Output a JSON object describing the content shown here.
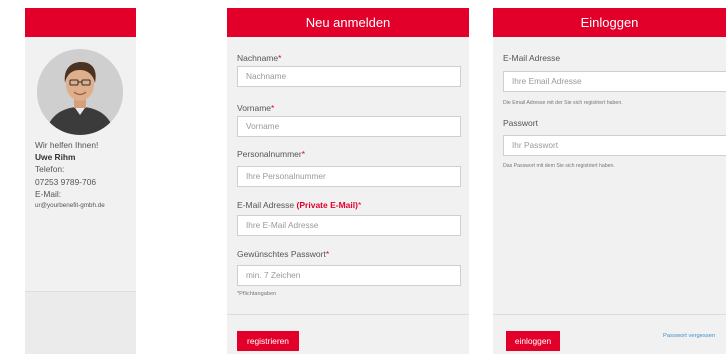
{
  "contact": {
    "help_text": "Wir helfen Ihnen!",
    "name": "Uwe Rihm",
    "phone_label": "Telefon:",
    "phone": "07253 9789-706",
    "email_label": "E-Mail:",
    "email": "ur@yourbenefit-gmbh.de"
  },
  "register": {
    "title": "Neu anmelden",
    "lastname_label": "Nachname",
    "lastname_placeholder": "Nachname",
    "firstname_label": "Vorname",
    "firstname_placeholder": "Vorname",
    "personnel_label": "Personalnummer",
    "personnel_placeholder": "Ihre Personalnummer",
    "email_label": "E-Mail Adresse",
    "email_private": "(Private E-Mail)",
    "email_placeholder": "Ihre E-Mail Adresse",
    "password_label": "Gewünschtes Passwort",
    "password_placeholder": "min. 7 Zeichen",
    "required_marker": "*",
    "required_note": "*Pflichtangaben",
    "submit_label": "registrieren"
  },
  "login": {
    "title": "Einloggen",
    "email_label": "E-Mail Adresse",
    "email_placeholder": "Ihre Email Adresse",
    "email_hint": "Die Email Adresse mit der Sie sich registriert haben.",
    "password_label": "Passwort",
    "password_placeholder": "Ihr Passwort",
    "password_hint": "Das Passwort mit dem Sie sich registriert haben.",
    "submit_label": "einloggen",
    "forgot_label": "Passwort vergessen"
  }
}
